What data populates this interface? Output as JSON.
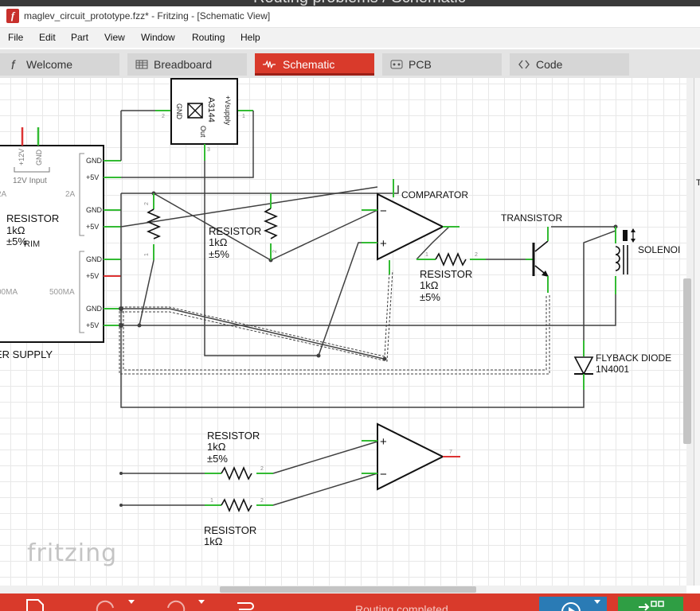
{
  "background_title": "Routing problems / Schematic",
  "window": {
    "title": "maglev_circuit_prototype.fzz* - Fritzing - [Schematic View]"
  },
  "menu": [
    "File",
    "Edit",
    "Part",
    "View",
    "Window",
    "Routing",
    "Help"
  ],
  "tabs": [
    {
      "label": "Welcome",
      "icon": "fritzing-f-icon",
      "active": false
    },
    {
      "label": "Breadboard",
      "icon": "breadboard-icon",
      "active": false
    },
    {
      "label": "Schematic",
      "icon": "schematic-wave-icon",
      "active": true
    },
    {
      "label": "PCB",
      "icon": "pcb-icon",
      "active": false
    },
    {
      "label": "Code",
      "icon": "code-brackets-icon",
      "active": false
    }
  ],
  "schematic": {
    "power_supply": {
      "label": "ER SUPPLY",
      "input_label": "12V Input",
      "input_pins": [
        "+12V",
        "GND"
      ],
      "left_amps": [
        "2A",
        "2A"
      ],
      "trim_label": "RIM",
      "ma_left": "00MA",
      "ma_right": "500MA",
      "pins": [
        "GND",
        "+5V",
        "GND",
        "+5V",
        "GND",
        "+5V",
        "GND",
        "+5V"
      ]
    },
    "hall_sensor": {
      "name": "A3144",
      "pin_gnd": "GND",
      "pin_supply": "+Vsupply",
      "pin_out": "Out",
      "pin_num_gnd": "2",
      "pin_num_supply": "1",
      "pin_num_out": "3"
    },
    "resistors": [
      {
        "name": "RESISTOR",
        "value": "1kΩ",
        "tol": "±5%"
      },
      {
        "name": "RESISTOR",
        "value": "1kΩ",
        "tol": "±5%"
      },
      {
        "name": "RESISTOR",
        "value": "1kΩ",
        "tol": "±5%"
      },
      {
        "name": "RESISTOR",
        "value": "1kΩ",
        "tol": "±5%"
      },
      {
        "name": "RESISTOR",
        "value": "1kΩ"
      }
    ],
    "comparator": {
      "label": "COMPARATOR",
      "minus": "−",
      "plus": "+"
    },
    "opamp2": {
      "minus": "−",
      "plus": "+"
    },
    "transistor": {
      "label": "TRANSISTOR"
    },
    "solenoid": {
      "label": "SOLENOI"
    },
    "diode": {
      "label": "FLYBACK DIODE",
      "part": "1N4001"
    },
    "pin_numbers": {
      "one": "1",
      "two": "2",
      "three": "3",
      "seven": "7"
    }
  },
  "watermark": "fritzing",
  "status": {
    "text": "Routing completed"
  },
  "right_panel": {
    "letter": "T"
  },
  "colors": {
    "accent": "#d93a2b",
    "wire": "#404040",
    "pin_green": "#33bb33",
    "pin_red": "#dd3333",
    "blue_button": "#2a7bb5",
    "green_button": "#2f9e44"
  }
}
